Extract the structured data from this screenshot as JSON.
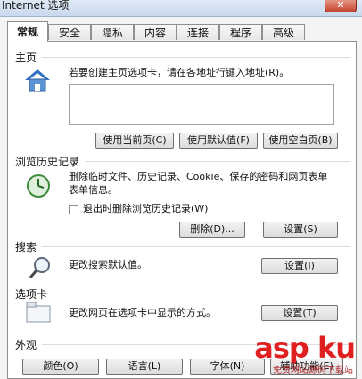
{
  "window": {
    "title": "Internet 选项",
    "close_label": "✕"
  },
  "tabs": [
    {
      "label": "常规",
      "active": true
    },
    {
      "label": "安全"
    },
    {
      "label": "隐私"
    },
    {
      "label": "内容"
    },
    {
      "label": "连接"
    },
    {
      "label": "程序"
    },
    {
      "label": "高级"
    }
  ],
  "homepage": {
    "section_label": "主页",
    "description": "若要创建主页选项卡，请在各地址行键入地址(R)。",
    "address_value": "",
    "buttons": {
      "use_current": "使用当前页(C)",
      "use_default": "使用默认值(F)",
      "use_blank": "使用空白页(B)"
    }
  },
  "history": {
    "section_label": "浏览历史记录",
    "description_line1": "删除临时文件、历史记录、Cookie、保存的密码和网页表单",
    "description_line2": "表单信息。",
    "checkbox_label": "退出时删除浏览历史记录(W)",
    "buttons": {
      "delete": "删除(D)...",
      "settings": "设置(S)"
    }
  },
  "search": {
    "section_label": "搜索",
    "description": "更改搜索默认值。",
    "settings_label": "设置(I)"
  },
  "tabs_section": {
    "section_label": "选项卡",
    "description": "更改网页在选项卡中显示的方式。",
    "settings_label": "设置(T)"
  },
  "appearance": {
    "section_label": "外观",
    "buttons": {
      "colors": "颜色(O)",
      "languages": "语言(L)",
      "fonts": "字体(N)",
      "accessibility": "辅助功能(E)"
    }
  },
  "watermark": {
    "main": "asp ku",
    "sub": "免费网站源码下载站"
  },
  "colors": {
    "watermark": "#e02020",
    "title_bar": "#c9d9ee",
    "close_button": "#c6452f"
  }
}
